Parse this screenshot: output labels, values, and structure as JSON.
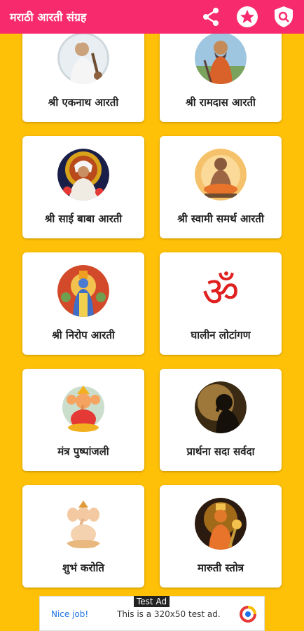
{
  "app": {
    "title": "मराठी आरती संग्रह"
  },
  "toolbar": {
    "share_icon": "share-icon",
    "rate_icon": "star-badge-icon",
    "privacy_icon": "shield-search-icon",
    "bar_color": "#F72A6E"
  },
  "cards": [
    {
      "label": "श्री एकनाथ आरती",
      "image": "saint-eknath-portrait"
    },
    {
      "label": "श्री रामदास आरती",
      "image": "saint-ramdas-portrait"
    },
    {
      "label": "श्री साई बाबा आरती",
      "image": "sai-baba-portrait"
    },
    {
      "label": "श्री स्वामी समर्थ आरती",
      "image": "swami-samarth-portrait"
    },
    {
      "label": "श्री निरोप आरती",
      "image": "vishnu-portrait"
    },
    {
      "label": "घालीन लोटांगण",
      "image": "om-symbol"
    },
    {
      "label": "मंत्र पुष्पांजली",
      "image": "ganesha-portrait"
    },
    {
      "label": "प्रार्थना सदा सर्वदा",
      "image": "prayer-silhouette"
    },
    {
      "label": "शुभं करोति",
      "image": "ganesha-idol"
    },
    {
      "label": "मारुती स्तोत्र",
      "image": "hanuman-portrait"
    }
  ],
  "ad": {
    "tag": "Test Ad",
    "headline": "Nice job!",
    "body": "This is a 320x50 test ad."
  },
  "colors": {
    "background": "#FFC107",
    "card": "#FFFFFF"
  }
}
